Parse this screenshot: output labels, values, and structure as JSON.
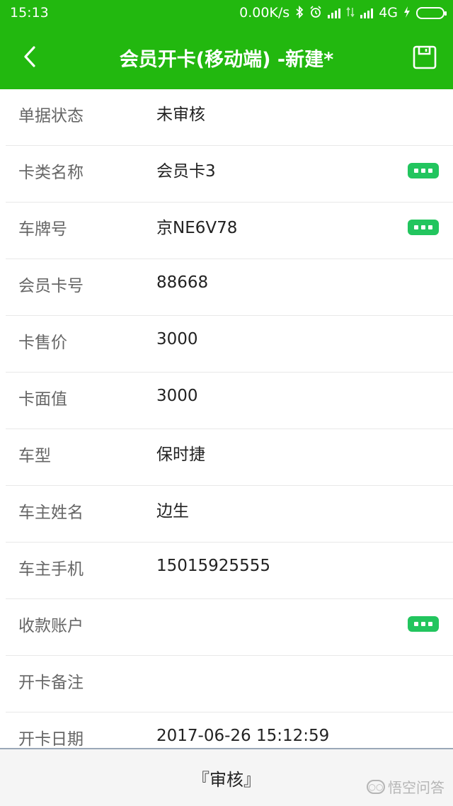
{
  "status_bar": {
    "time": "15:13",
    "net_speed": "0.00K/s",
    "network": "4G",
    "icons": [
      "bluetooth-icon",
      "alarm-icon",
      "signal-icon",
      "data-arrows-icon",
      "signal-icon",
      "charging-icon",
      "battery-icon"
    ]
  },
  "header": {
    "title": "会员开卡(移动端) -新建*",
    "back_icon": "chevron-left-icon",
    "save_icon": "save-icon"
  },
  "form": {
    "rows": [
      {
        "label": "单据状态",
        "value": "未审核",
        "has_picker": false
      },
      {
        "label": "卡类名称",
        "value": "会员卡3",
        "has_picker": true
      },
      {
        "label": "车牌号",
        "value": "京NE6V78",
        "has_picker": true
      },
      {
        "label": "会员卡号",
        "value": "88668",
        "has_picker": false
      },
      {
        "label": "卡售价",
        "value": "3000",
        "has_picker": false
      },
      {
        "label": "卡面值",
        "value": "3000",
        "has_picker": false
      },
      {
        "label": "车型",
        "value": "保时捷",
        "has_picker": false
      },
      {
        "label": "车主姓名",
        "value": "边生",
        "has_picker": false
      },
      {
        "label": "车主手机",
        "value": "15015925555",
        "has_picker": false
      },
      {
        "label": "收款账户",
        "value": "",
        "has_picker": true
      },
      {
        "label": "开卡备注",
        "value": "",
        "has_picker": false
      },
      {
        "label": "开卡日期",
        "value": "2017-06-26 15:12:59",
        "has_picker": false
      }
    ]
  },
  "footer": {
    "audit_label": "『审核』"
  },
  "watermark": {
    "text": "悟空问答"
  },
  "colors": {
    "brand": "#22b80f",
    "picker": "#22c55e",
    "label": "#666666",
    "value": "#222222"
  }
}
